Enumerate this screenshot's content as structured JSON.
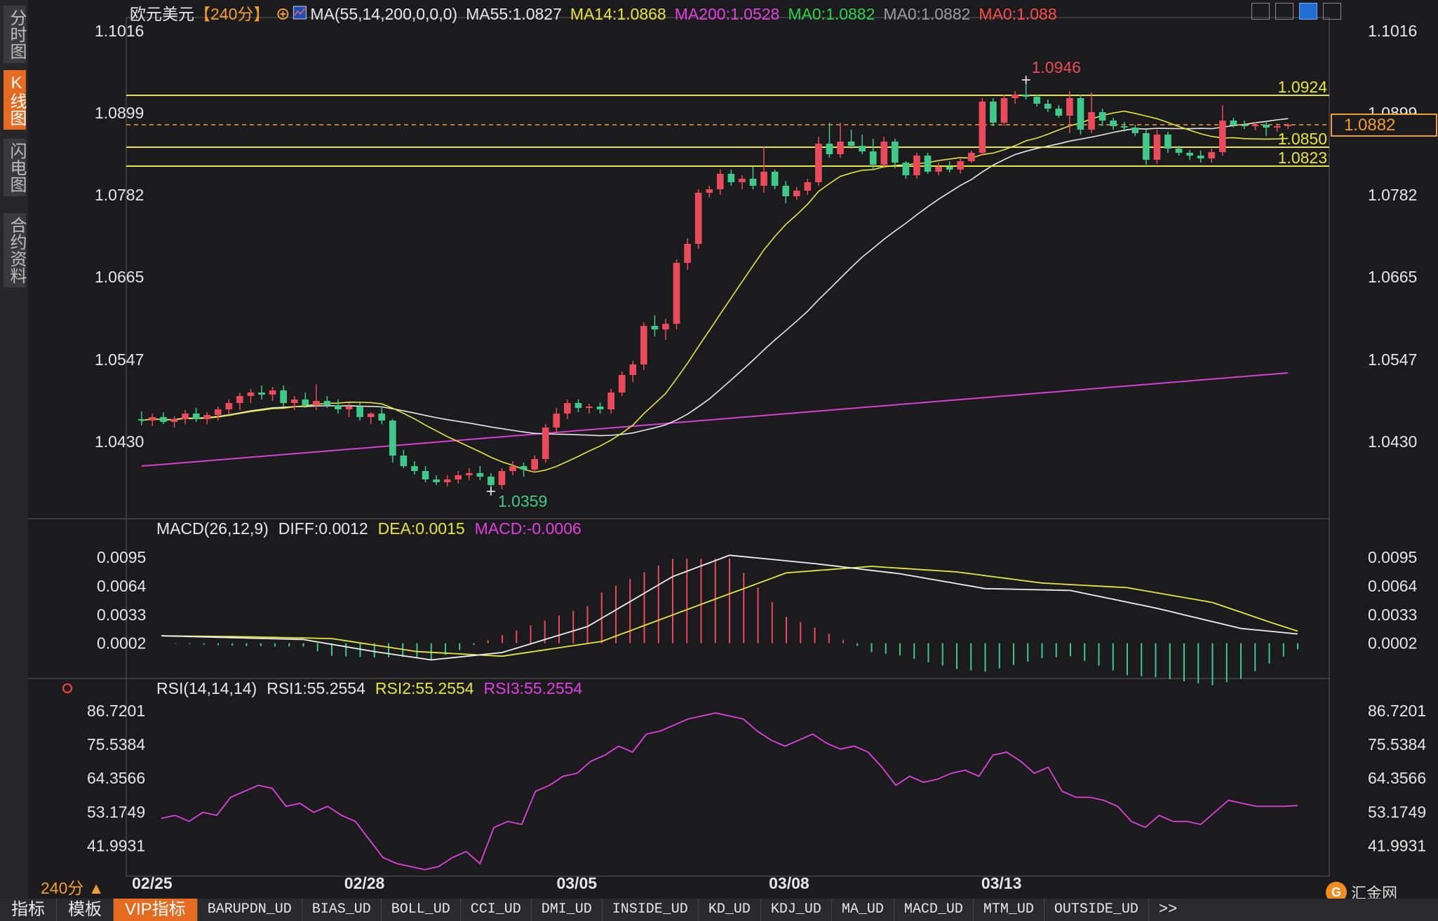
{
  "sidebar": {
    "tabs": [
      {
        "label": "分时图",
        "active": false
      },
      {
        "label": "K线图",
        "active": true
      },
      {
        "label": "闪电图",
        "active": false
      },
      {
        "label": "合约资料",
        "active": false
      }
    ]
  },
  "header": {
    "symbol": "欧元美元",
    "period_tag": "【240分】",
    "add_icon": "circle-plus-icon",
    "indicator": "MA(55,14,200,0,0,0)",
    "ma_values": [
      {
        "label": "MA55:1.0827",
        "color": "#e8e8e8"
      },
      {
        "label": "MA14:1.0868",
        "color": "#e6e63a"
      },
      {
        "label": "MA200:1.0528",
        "color": "#e040e0"
      },
      {
        "label": "MA0:1.0882",
        "color": "#2ad24a"
      },
      {
        "label": "MA0:1.0882",
        "color": "#9a9a9a"
      },
      {
        "label": "MA0:1.088",
        "color": "#ff4a4a"
      }
    ]
  },
  "colors": {
    "up": "#e94b5b",
    "down": "#3ec98a",
    "ma55": "#e8e8e8",
    "ma14": "#e6e63a",
    "ma200": "#d43fd4",
    "level": "#e6e63a"
  },
  "chart_data": [
    {
      "type": "candlestick",
      "title": "欧元美元 240分",
      "x_ticks": [
        "02/25",
        "02/28",
        "03/05",
        "03/08",
        "03/13"
      ],
      "x_tick_index": [
        1,
        21,
        41,
        61,
        81
      ],
      "y_ticks": [
        "1.1016",
        "1.0899",
        "1.0782",
        "1.0665",
        "1.0547",
        "1.0430"
      ],
      "ylim": [
        1.0345,
        1.103
      ],
      "high_label": "1.0946",
      "low_label": "1.0359",
      "current_price": "1.0882",
      "levels": [
        {
          "value": 1.0924,
          "label": "1.0924"
        },
        {
          "value": 1.085,
          "label": "1.0850"
        },
        {
          "value": 1.0823,
          "label": "1.0823"
        }
      ],
      "ohlc": [
        [
          1.0462,
          1.0473,
          1.0453,
          1.046
        ],
        [
          1.046,
          1.047,
          1.0452,
          1.0465
        ],
        [
          1.0465,
          1.0472,
          1.0455,
          1.0458
        ],
        [
          1.0458,
          1.0466,
          1.045,
          1.0462
        ],
        [
          1.0462,
          1.0475,
          1.0455,
          1.047
        ],
        [
          1.047,
          1.0478,
          1.0458,
          1.0462
        ],
        [
          1.0462,
          1.0472,
          1.0455,
          1.0468
        ],
        [
          1.0468,
          1.048,
          1.046,
          1.0476
        ],
        [
          1.0476,
          1.049,
          1.0468,
          1.0485
        ],
        [
          1.0485,
          1.05,
          1.0475,
          1.0495
        ],
        [
          1.0495,
          1.0505,
          1.0485,
          1.05
        ],
        [
          1.05,
          1.051,
          1.049,
          1.0497
        ],
        [
          1.0497,
          1.0508,
          1.0488,
          1.0503
        ],
        [
          1.0503,
          1.051,
          1.048,
          1.0485
        ],
        [
          1.0485,
          1.0495,
          1.0475,
          1.049
        ],
        [
          1.049,
          1.05,
          1.0478,
          1.0482
        ],
        [
          1.0482,
          1.0512,
          1.0475,
          1.0488
        ],
        [
          1.0488,
          1.0495,
          1.0478,
          1.0482
        ],
        [
          1.0482,
          1.049,
          1.047,
          1.0476
        ],
        [
          1.0476,
          1.0485,
          1.0465,
          1.048
        ],
        [
          1.048,
          1.0485,
          1.046,
          1.0465
        ],
        [
          1.0465,
          1.0472,
          1.0455,
          1.047
        ],
        [
          1.047,
          1.048,
          1.0455,
          1.046
        ],
        [
          1.046,
          1.0462,
          1.04,
          1.041
        ],
        [
          1.041,
          1.0418,
          1.0392,
          1.0395
        ],
        [
          1.0395,
          1.0402,
          1.0383,
          1.0388
        ],
        [
          1.0388,
          1.0395,
          1.0372,
          1.0376
        ],
        [
          1.0376,
          1.0382,
          1.0368,
          1.0372
        ],
        [
          1.0372,
          1.0382,
          1.0366,
          1.0376
        ],
        [
          1.0376,
          1.0388,
          1.037,
          1.0382
        ],
        [
          1.0382,
          1.0392,
          1.0375,
          1.0385
        ],
        [
          1.0385,
          1.0395,
          1.0375,
          1.038
        ],
        [
          1.038,
          1.0385,
          1.0359,
          1.0368
        ],
        [
          1.0368,
          1.0392,
          1.0362,
          1.0388
        ],
        [
          1.0388,
          1.0402,
          1.0382,
          1.0395
        ],
        [
          1.0395,
          1.04,
          1.038,
          1.039
        ],
        [
          1.039,
          1.041,
          1.0385,
          1.0405
        ],
        [
          1.0405,
          1.0455,
          1.04,
          1.045
        ],
        [
          1.045,
          1.0478,
          1.0442,
          1.047
        ],
        [
          1.047,
          1.049,
          1.0462,
          1.0485
        ],
        [
          1.0485,
          1.049,
          1.0472,
          1.0478
        ],
        [
          1.0478,
          1.0484,
          1.047,
          1.048
        ],
        [
          1.048,
          1.0486,
          1.047,
          1.0476
        ],
        [
          1.0476,
          1.0505,
          1.047,
          1.05
        ],
        [
          1.05,
          1.053,
          1.0495,
          1.0525
        ],
        [
          1.0525,
          1.0545,
          1.0515,
          1.054
        ],
        [
          1.054,
          1.06,
          1.0532,
          1.0595
        ],
        [
          1.0595,
          1.061,
          1.058,
          1.059
        ],
        [
          1.059,
          1.0605,
          1.0575,
          1.0598
        ],
        [
          1.0598,
          1.069,
          1.059,
          1.0685
        ],
        [
          1.0685,
          1.072,
          1.0675,
          1.0712
        ],
        [
          1.0712,
          1.079,
          1.0705,
          1.0785
        ],
        [
          1.0785,
          1.0795,
          1.0778,
          1.079
        ],
        [
          1.079,
          1.0818,
          1.0782,
          1.0812
        ],
        [
          1.0812,
          1.0818,
          1.0795,
          1.08
        ],
        [
          1.08,
          1.081,
          1.079,
          1.0805
        ],
        [
          1.0805,
          1.0822,
          1.079,
          1.0795
        ],
        [
          1.0795,
          1.085,
          1.0785,
          1.0815
        ],
        [
          1.0815,
          1.0818,
          1.079,
          1.0795
        ],
        [
          1.0795,
          1.0802,
          1.077,
          1.078
        ],
        [
          1.078,
          1.0793,
          1.0775,
          1.0788
        ],
        [
          1.0788,
          1.0805,
          1.0782,
          1.08
        ],
        [
          1.08,
          1.0865,
          1.0795,
          1.0855
        ],
        [
          1.0855,
          1.0885,
          1.0835,
          1.084
        ],
        [
          1.084,
          1.0885,
          1.0835,
          1.0858
        ],
        [
          1.0858,
          1.0875,
          1.0848,
          1.0852
        ],
        [
          1.0852,
          1.0868,
          1.084,
          1.0844
        ],
        [
          1.0844,
          1.0862,
          1.0818,
          1.0825
        ],
        [
          1.0825,
          1.0865,
          1.082,
          1.0858
        ],
        [
          1.0858,
          1.0862,
          1.082,
          1.0828
        ],
        [
          1.0828,
          1.083,
          1.0805,
          1.081
        ],
        [
          1.081,
          1.0842,
          1.0805,
          1.0838
        ],
        [
          1.0838,
          1.0842,
          1.0812,
          1.0815
        ],
        [
          1.0815,
          1.0828,
          1.081,
          1.0822
        ],
        [
          1.0822,
          1.083,
          1.0814,
          1.0818
        ],
        [
          1.0818,
          1.0835,
          1.0812,
          1.083
        ],
        [
          1.083,
          1.0845,
          1.0828,
          1.0842
        ],
        [
          1.0842,
          1.092,
          1.0838,
          1.0915
        ],
        [
          1.0915,
          1.092,
          1.088,
          1.0885
        ],
        [
          1.0885,
          1.0925,
          1.088,
          1.092
        ],
        [
          1.092,
          1.093,
          1.0912,
          1.0925
        ],
        [
          1.0925,
          1.0946,
          1.0918,
          1.0922
        ],
        [
          1.0922,
          1.0925,
          1.0908,
          1.0912
        ],
        [
          1.0912,
          1.0918,
          1.09,
          1.0905
        ],
        [
          1.0905,
          1.091,
          1.0892,
          1.0895
        ],
        [
          1.0895,
          1.093,
          1.087,
          1.092
        ],
        [
          1.092,
          1.0925,
          1.0868,
          1.0875
        ],
        [
          1.0875,
          1.0928,
          1.087,
          1.09
        ],
        [
          1.09,
          1.0905,
          1.088,
          1.0888
        ],
        [
          1.0888,
          1.0892,
          1.0875,
          1.088
        ],
        [
          1.088,
          1.0886,
          1.0872,
          1.0878
        ],
        [
          1.0878,
          1.0882,
          1.0866,
          1.087
        ],
        [
          1.087,
          1.0875,
          1.0825,
          1.0832
        ],
        [
          1.0832,
          1.0875,
          1.0826,
          1.0868
        ],
        [
          1.0868,
          1.0872,
          1.0842,
          1.0848
        ],
        [
          1.0848,
          1.0852,
          1.0838,
          1.0842
        ],
        [
          1.0842,
          1.0846,
          1.0832,
          1.0838
        ],
        [
          1.0838,
          1.0845,
          1.0828,
          1.0834
        ],
        [
          1.0834,
          1.0848,
          1.0828,
          1.0843
        ],
        [
          1.0843,
          1.091,
          1.0838,
          1.0888
        ],
        [
          1.0888,
          1.0892,
          1.0878,
          1.0882
        ],
        [
          1.0882,
          1.0888,
          1.0876,
          1.088
        ],
        [
          1.088,
          1.0886,
          1.0874,
          1.0882
        ],
        [
          1.0882,
          1.0888,
          1.0866,
          1.0878
        ],
        [
          1.0878,
          1.0884,
          1.0872,
          1.088
        ],
        [
          1.088,
          1.0884,
          1.0876,
          1.0882
        ]
      ]
    },
    {
      "type": "line",
      "title": "MACD(26,12,9)",
      "series": [
        {
          "name": "DIFF",
          "value_label": "DIFF:0.0012"
        },
        {
          "name": "DEA",
          "value_label": "DEA:0.0015"
        },
        {
          "name": "MACD",
          "value_label": "MACD:-0.0006"
        }
      ],
      "y_ticks": [
        "0.0095",
        "0.0064",
        "0.0033",
        "0.0002"
      ],
      "ylim": [
        -0.003,
        0.011
      ],
      "diff_points": [
        [
          0,
          0.001
        ],
        [
          10,
          0.0008
        ],
        [
          20,
          0.0006
        ],
        [
          30,
          -0.0007
        ],
        [
          38,
          -0.0016
        ],
        [
          48,
          -0.0008
        ],
        [
          60,
          0.002
        ],
        [
          72,
          0.0074
        ],
        [
          80,
          0.0097
        ],
        [
          92,
          0.0088
        ],
        [
          104,
          0.0077
        ],
        [
          116,
          0.0061
        ],
        [
          128,
          0.0059
        ],
        [
          140,
          0.004
        ],
        [
          152,
          0.0018
        ],
        [
          160,
          0.0012
        ]
      ],
      "dea_points": [
        [
          0,
          0.001
        ],
        [
          12,
          0.0009
        ],
        [
          24,
          0.0007
        ],
        [
          36,
          -0.0007
        ],
        [
          48,
          -0.0012
        ],
        [
          62,
          0.0004
        ],
        [
          76,
          0.0044
        ],
        [
          88,
          0.0078
        ],
        [
          100,
          0.0085
        ],
        [
          112,
          0.0079
        ],
        [
          124,
          0.0067
        ],
        [
          136,
          0.0062
        ],
        [
          148,
          0.0046
        ],
        [
          156,
          0.0025
        ],
        [
          160,
          0.0015
        ]
      ],
      "hist_peak_index": 80
    },
    {
      "type": "line",
      "title": "RSI(14,14,14)",
      "series": [
        {
          "name": "RSI1",
          "value_label": "RSI1:55.2554"
        },
        {
          "name": "RSI2",
          "value_label": "RSI2:55.2554"
        },
        {
          "name": "RSI3",
          "value_label": "RSI3:55.2554"
        }
      ],
      "y_ticks": [
        "86.7201",
        "75.5384",
        "64.3566",
        "53.1749",
        "41.9931"
      ],
      "ylim": [
        33,
        90
      ],
      "values": [
        51,
        52,
        50,
        53,
        52,
        58,
        60,
        62,
        61,
        55,
        56,
        53,
        55,
        52,
        50,
        44,
        38,
        36,
        35,
        34,
        35,
        38,
        40,
        36,
        48,
        50,
        49,
        60,
        62,
        65,
        66,
        70,
        72,
        75,
        73,
        79,
        80,
        82,
        84,
        85,
        86,
        85,
        84,
        80,
        77,
        75,
        77,
        79,
        76,
        74,
        75,
        73,
        68,
        62,
        65,
        63,
        64,
        66,
        67,
        65,
        72,
        73,
        70,
        66,
        68,
        60,
        58,
        58,
        57,
        55,
        50,
        48,
        52,
        50,
        50,
        49,
        53,
        57,
        56,
        55,
        55,
        55,
        55.2554
      ]
    }
  ],
  "bottom_bar": {
    "tabs": [
      "指标",
      "模板",
      "VIP指标",
      "BARUPDN_UD",
      "BIAS_UD",
      "BOLL_UD",
      "CCI_UD",
      "DMI_UD",
      "INSIDE_UD",
      "KD_UD",
      "KDJ_UD",
      "MA_UD",
      "MACD_UD",
      "MTM_UD",
      "OUTSIDE_UD"
    ],
    "active": "VIP指标",
    "more": ">>"
  },
  "period_selector": "240分 ▲",
  "brand": {
    "mark": "G",
    "name": "汇金网"
  }
}
